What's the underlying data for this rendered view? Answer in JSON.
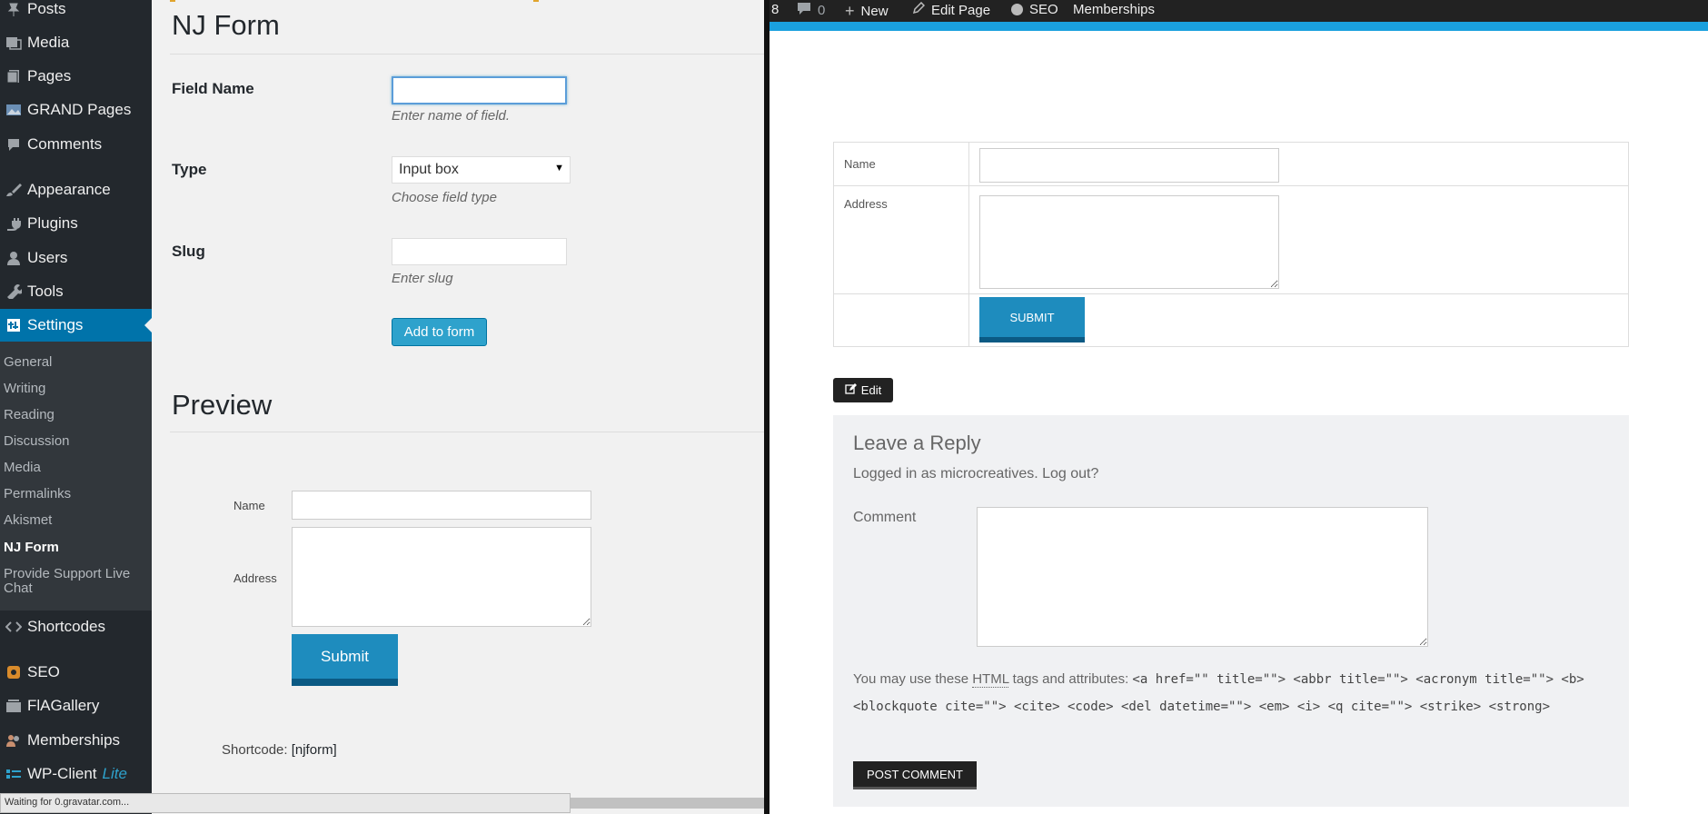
{
  "sidebar": {
    "items": [
      {
        "label": "Posts",
        "icon": "pin-icon"
      },
      {
        "label": "Media",
        "icon": "media-icon"
      },
      {
        "label": "Pages",
        "icon": "page-icon"
      },
      {
        "label": "GRAND Pages",
        "icon": "image-icon"
      },
      {
        "label": "Comments",
        "icon": "comment-icon"
      },
      {
        "label": "Appearance",
        "icon": "brush-icon"
      },
      {
        "label": "Plugins",
        "icon": "plug-icon"
      },
      {
        "label": "Users",
        "icon": "user-icon"
      },
      {
        "label": "Tools",
        "icon": "wrench-icon"
      },
      {
        "label": "Settings",
        "icon": "settings-icon"
      },
      {
        "label": "Shortcodes",
        "icon": "code-icon"
      },
      {
        "label": "SEO",
        "icon": "seo-icon"
      },
      {
        "label": "FlAGallery",
        "icon": "gallery-icon"
      },
      {
        "label": "Memberships",
        "icon": "members-icon"
      },
      {
        "label": "WP-Client",
        "suffix": "Lite",
        "icon": "client-icon"
      }
    ],
    "submenu": [
      "General",
      "Writing",
      "Reading",
      "Discussion",
      "Media",
      "Permalinks",
      "Akismet",
      "NJ Form",
      "Provide Support Live",
      "Chat"
    ]
  },
  "admin_form": {
    "title": "NJ Form",
    "field_name_label": "Field Name",
    "field_name_desc": "Enter name of field.",
    "type_label": "Type",
    "type_value": "Input box",
    "type_desc": "Choose field type",
    "slug_label": "Slug",
    "slug_desc": "Enter slug",
    "add_button": "Add to form"
  },
  "preview": {
    "title": "Preview",
    "name_label": "Name",
    "address_label": "Address",
    "submit": "Submit",
    "shortcode_label": "Shortcode:",
    "shortcode_value": "[njform]"
  },
  "status_bar": "Waiting for 0.gravatar.com...",
  "adminbar": {
    "count": "8",
    "comments": "0",
    "new": "New",
    "edit_page": "Edit Page",
    "seo": "SEO",
    "memberships": "Memberships"
  },
  "front_form": {
    "name_label": "Name",
    "address_label": "Address",
    "submit": "SUBMIT"
  },
  "edit_button": "Edit",
  "reply": {
    "title": "Leave a Reply",
    "logged_in": "Logged in as microcreatives. Log out?",
    "comment_label": "Comment",
    "allowed_prefix": "You may use these",
    "allowed_abbr": "HTML",
    "allowed_mid": "tags and attributes:",
    "allowed_code": "<a href=\"\" title=\"\"> <abbr title=\"\"> <acronym title=\"\"> <b> <blockquote cite=\"\"> <cite> <code> <del datetime=\"\"> <em> <i> <q cite=\"\"> <strike> <strong>",
    "post_button": "POST COMMENT"
  },
  "colors": {
    "sidebar_bg": "#23282d",
    "accent": "#0073aa",
    "button_blue": "#1e8cbe",
    "adminbar_strip": "#1aa0de"
  }
}
